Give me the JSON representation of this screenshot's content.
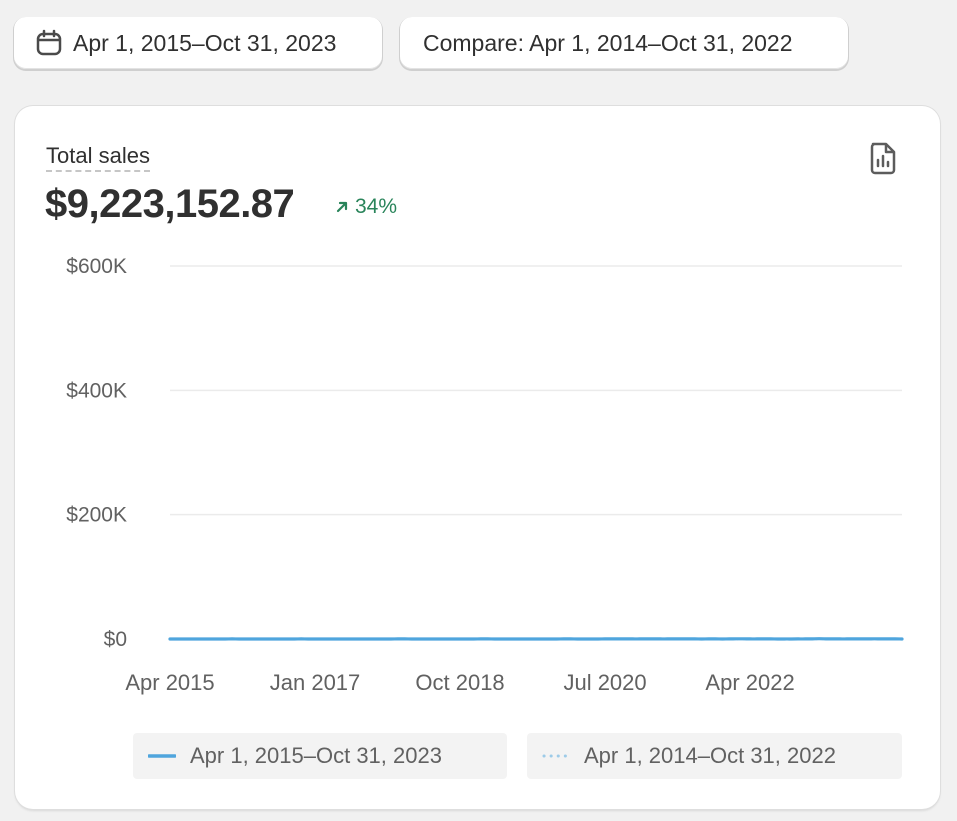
{
  "date_range": {
    "label": "Apr 1, 2015–Oct 31, 2023"
  },
  "compare": {
    "label": "Compare: Apr 1, 2014–Oct 31, 2022"
  },
  "metric": {
    "label": "Total sales",
    "value": "$9,223,152.87",
    "change": "34%"
  },
  "colors": {
    "primary": "#4fa5dd",
    "comparison": "#9dcbe8",
    "positive": "#29845a"
  },
  "chart_data": {
    "type": "line",
    "ylim": [
      0,
      600000
    ],
    "y_ticks": [
      0,
      200000,
      400000,
      600000
    ],
    "y_tick_labels": [
      "$0",
      "$200K",
      "$400K",
      "$600K"
    ],
    "x_tick_labels": [
      "Apr 2015",
      "Jan 2017",
      "Oct 2018",
      "Jul 2020",
      "Apr 2022"
    ],
    "x_tick_index": [
      0,
      21,
      42,
      63,
      84
    ],
    "grid": true,
    "legend": "bottom",
    "series": [
      {
        "name": "Apr 1, 2015–Oct 31, 2023",
        "style": "solid",
        "values": [
          0,
          0,
          0,
          0,
          0,
          0,
          65,
          18,
          0,
          120,
          30,
          65,
          30,
          65,
          35,
          30,
          38,
          40,
          40,
          135,
          60,
          25,
          40,
          42,
          45,
          40,
          50,
          30,
          30,
          30,
          32,
          35,
          40,
          120,
          105,
          40,
          42,
          35,
          40,
          65,
          42,
          40,
          36,
          35,
          45,
          140,
          145,
          38,
          35,
          35,
          36,
          32,
          40,
          42,
          38,
          50,
          55,
          175,
          195,
          40,
          45,
          70,
          75,
          95,
          95,
          90,
          85,
          90,
          85,
          225,
          205,
          90,
          90,
          92,
          95,
          105,
          110,
          75,
          110,
          150,
          80,
          150,
          300,
          320,
          90,
          85,
          90,
          100,
          75,
          80,
          80,
          85,
          95,
          200,
          460,
          200,
          190,
          85,
          90,
          100,
          140,
          210,
          300,
          205,
          225,
          200,
          50
        ]
      },
      {
        "name": "Apr 1, 2014–Oct 31, 2022",
        "style": "dotted",
        "values": [
          0,
          0,
          0,
          0,
          0,
          0,
          0,
          0,
          0,
          0,
          0,
          0,
          0,
          0,
          0,
          0,
          0,
          0,
          0,
          0,
          55,
          70,
          20,
          120,
          70,
          60,
          45,
          60,
          30,
          35,
          32,
          35,
          40,
          135,
          100,
          20,
          40,
          35,
          45,
          50,
          40,
          38,
          35,
          35,
          40,
          125,
          135,
          38,
          35,
          35,
          32,
          32,
          60,
          65,
          40,
          45,
          95,
          150,
          35,
          35,
          35,
          40,
          30,
          40,
          35,
          50,
          55,
          160,
          150,
          40,
          55,
          70,
          70,
          90,
          100,
          100,
          90,
          95,
          105,
          105,
          60,
          145,
          230,
          170,
          95,
          90,
          95,
          100,
          95,
          95,
          135,
          85,
          145,
          250,
          320,
          290,
          95,
          90,
          90,
          95,
          75,
          75,
          80,
          90,
          100,
          200
        ]
      }
    ]
  }
}
